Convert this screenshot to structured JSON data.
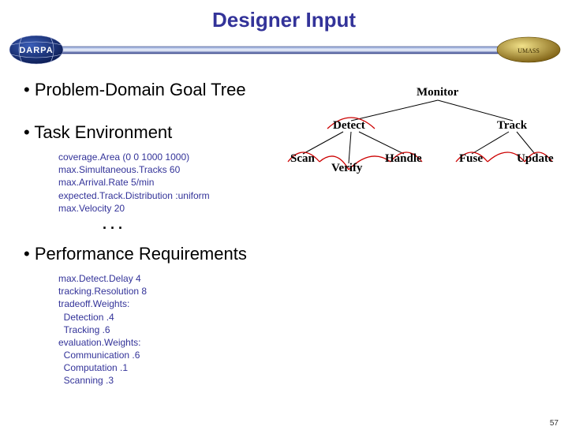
{
  "title": "Designer Input",
  "bullets": {
    "b1": "Problem-Domain Goal Tree",
    "b2": "Task Environment",
    "b3": "Performance Requirements"
  },
  "tree": {
    "root": "Monitor",
    "l1": {
      "a": "Detect",
      "b": "Track"
    },
    "l2": {
      "a": "Scan",
      "b": "Verify",
      "c": "Handle",
      "d": "Fuse",
      "e": "Update"
    }
  },
  "env": {
    "l1": "coverage.Area (0 0 1000 1000)",
    "l2": "max.Simultaneous.Tracks 60",
    "l3": "max.Arrival.Rate 5/min",
    "l4": "expected.Track.Distribution :uniform",
    "l5": "max.Velocity 20"
  },
  "dots": ". . .",
  "perf": {
    "l1": "max.Detect.Delay 4",
    "l2": "tracking.Resolution 8",
    "l3": "tradeoff.Weights:",
    "l4": "  Detection .4",
    "l5": "  Tracking .6",
    "l6": "evaluation.Weights:",
    "l7": "  Communication .6",
    "l8": "  Computation .1",
    "l9": "  Scanning .3"
  },
  "pagenum": "57",
  "logos": {
    "left": "darpa-logo",
    "right": "umass-logo"
  }
}
